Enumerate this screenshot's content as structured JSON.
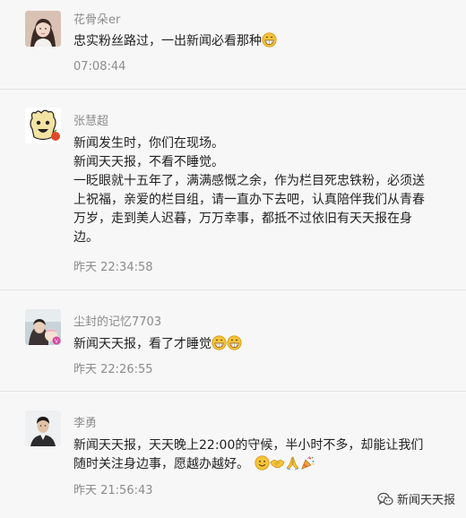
{
  "comments": [
    {
      "user": "花骨朵er",
      "avatar": "avatar-young-woman",
      "lines": [
        "忠实粉丝路过，一出新闻必看那种"
      ],
      "emoji": [
        "grin-emoji"
      ],
      "time": "07:08:44"
    },
    {
      "user": "张慧超",
      "avatar": "avatar-cartoon-character",
      "lines": [
        "新闻发生时，你们在现场。",
        "新闻天天报，不看不睡觉。",
        "一眨眼就十五年了，满满感慨之余，作为栏目死忠铁粉，必须送",
        "上祝福，亲爱的栏目组，请一直办下去吧，认真陪伴我们从青春",
        "万岁，走到美人迟暮，万万幸事，都抵不过依旧有天天报在身",
        "边。"
      ],
      "time": "昨天 22:34:58"
    },
    {
      "user": "尘封的记忆7703",
      "avatar": "avatar-mother-child",
      "lines": [
        "新闻天天报，看了才睡觉"
      ],
      "emoji": [
        "grin-emoji",
        "grin-emoji"
      ],
      "time": "昨天 22:26:55"
    },
    {
      "user": "李勇",
      "avatar": "avatar-man",
      "lines": [
        "新闻天天报，天天晚上22:00的守候，半小时不多，却能让我们",
        "随时关注身边事，愿越办越好。"
      ],
      "emoji": [
        "smile-emoji",
        "handshake-emoji",
        "pray-emoji",
        "party-emoji"
      ],
      "time": "昨天 21:56:43"
    }
  ],
  "watermark": {
    "text": "新闻天天报",
    "icon": "wechat-icon"
  },
  "colors": {
    "background": "#f7f7f7",
    "meta": "#8c8c8c",
    "text": "#222222",
    "divider": "#e3e3e3"
  }
}
